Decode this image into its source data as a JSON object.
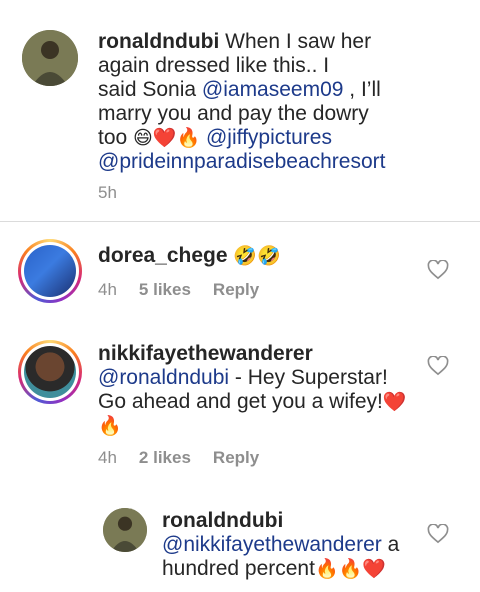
{
  "comments": [
    {
      "username": "ronaldndubi",
      "body_1": "When I saw her",
      "body_2": "again dressed like this.. I",
      "body_3": "said Sonia ",
      "mention_1": "@iamaseem09",
      "body_4": " , I’ll",
      "body_5": "marry you and pay the dowry",
      "body_6": "too ",
      "emoji_1": "😄❤️🔥",
      "mention_2": " @jiffypictures",
      "mention_3": "@prideinnparadisebeachresort",
      "time": "5h"
    },
    {
      "username": "dorea_chege",
      "emoji": "🤣🤣",
      "time": "4h",
      "likes": "5 likes",
      "reply": "Reply"
    },
    {
      "username": "nikkifayethewanderer",
      "mention": "@ronaldndubi",
      "body_1": " - Hey Superstar!",
      "body_2": "Go ahead and get you a wifey!",
      "emoji_1": "❤️",
      "emoji_2": "🔥",
      "time": "4h",
      "likes": "2 likes",
      "reply": "Reply"
    },
    {
      "username": "ronaldndubi",
      "mention": "@nikkifayethewanderer",
      "body_1": " a",
      "body_2": "hundred percent",
      "emoji": "🔥🔥❤️"
    }
  ],
  "icons": {
    "like": "heart-outline-icon"
  },
  "colors": {
    "mention": "#1d3a8a",
    "meta": "#8e8e8e",
    "divider": "#dbdbdb"
  }
}
